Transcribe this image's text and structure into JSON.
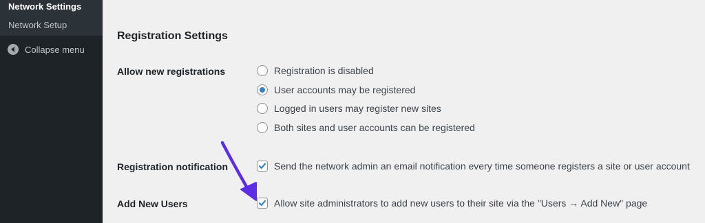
{
  "sidebar": {
    "submenu": [
      {
        "label": "Network Settings",
        "current": true
      },
      {
        "label": "Network Setup",
        "current": false
      }
    ],
    "collapse_label": "Collapse menu"
  },
  "main": {
    "section_title": "Registration Settings",
    "allow_registrations": {
      "label": "Allow new registrations",
      "options": [
        {
          "label": "Registration is disabled",
          "checked": false
        },
        {
          "label": "User accounts may be registered",
          "checked": true
        },
        {
          "label": "Logged in users may register new sites",
          "checked": false
        },
        {
          "label": "Both sites and user accounts can be registered",
          "checked": false
        }
      ]
    },
    "registration_notification": {
      "label": "Registration notification",
      "checkbox_label": "Send the network admin an email notification every time someone registers a site or user account",
      "checked": true
    },
    "add_new_users": {
      "label": "Add New Users",
      "checkbox_label": "Allow site administrators to add new users to their site via the \"Users → Add New\" page",
      "checked": true
    }
  },
  "colors": {
    "sidebar_bg": "#1d2327",
    "accent": "#3582c4",
    "annotation_arrow": "#5b2ee5"
  }
}
